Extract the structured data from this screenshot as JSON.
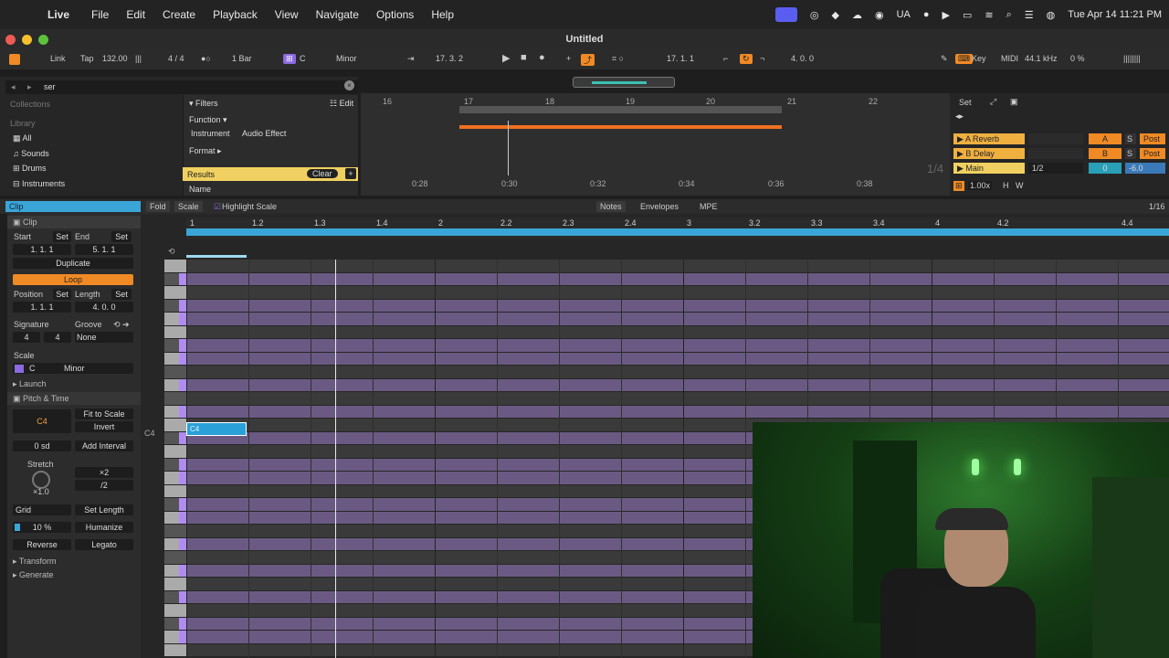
{
  "menubar": {
    "apple": "",
    "app": "Live",
    "items": [
      "File",
      "Edit",
      "Create",
      "Playback",
      "View",
      "Navigate",
      "Options",
      "Help"
    ],
    "status": {
      "ua": "UA",
      "datetime": "Tue Apr 14  11:21 PM"
    }
  },
  "window": {
    "title": "Untitled"
  },
  "control_bar": {
    "link": "Link",
    "tap": "Tap",
    "tempo": "132.00",
    "signature": "4 / 4",
    "quant": "1 Bar",
    "key_root": "C",
    "key_scale": "Minor",
    "arr_pos": "17.   3.   2",
    "loop_start": "17.   1.   1",
    "loop_len": "4.   0.   0",
    "key_btn": "Key",
    "midi_btn": "MIDI",
    "sample_rate": "44.1 kHz",
    "cpu": "0 %"
  },
  "browser": {
    "search_value": "ser",
    "collections_label": "Collections",
    "library_label": "Library",
    "library_items": [
      "All",
      "Sounds",
      "Drums",
      "Instruments"
    ],
    "filters_label": "Filters",
    "edit_label": "Edit",
    "function_label": "Function",
    "function_tags": [
      "Instrument",
      "Audio Effect"
    ],
    "format_label": "Format",
    "results_label": "Results",
    "clear_label": "Clear",
    "name_header": "Name"
  },
  "arrangement": {
    "bars": [
      "16",
      "17",
      "18",
      "19",
      "20",
      "21",
      "22"
    ],
    "times": [
      "0:28",
      "0:30",
      "0:32",
      "0:34",
      "0:36",
      "0:38"
    ]
  },
  "mixer": {
    "set_label": "Set",
    "returns": [
      {
        "name": "A Reverb",
        "letter": "A",
        "send": "S",
        "post": "Post"
      },
      {
        "name": "B Delay",
        "letter": "B",
        "send": "S",
        "post": "Post"
      }
    ],
    "main": {
      "name": "Main",
      "input": "1/2",
      "vol": "0",
      "pan": "-6.0"
    },
    "cue": "1/4",
    "speed": "1.00x",
    "h_label": "H",
    "w_label": "W"
  },
  "clip_bar": {
    "title": "Clip",
    "fold": "Fold",
    "scale": "Scale",
    "highlight": "Highlight Scale",
    "notes": "Notes",
    "envelopes": "Envelopes",
    "mpe": "MPE",
    "grid_res": "1/16"
  },
  "clip_panel": {
    "clip_header": "Clip",
    "start_label": "Start",
    "end_label": "End",
    "set_label": "Set",
    "start_value": "1.   1.   1",
    "end_value": "5.   1.   1",
    "duplicate": "Duplicate",
    "loop": "Loop",
    "position_label": "Position",
    "length_label": "Length",
    "position_value": "1.   1.   1",
    "length_value": "4.   0.   0",
    "signature_label": "Signature",
    "groove_label": "Groove",
    "sig_num": "4",
    "sig_den": "4",
    "groove_value": "None",
    "scale_label": "Scale",
    "scale_root": "C",
    "scale_mode": "Minor",
    "launch": "Launch",
    "pitch_time": "Pitch & Time",
    "note_name": "C4",
    "fit_to_scale": "Fit to Scale",
    "invert": "Invert",
    "transpose": "0 sd",
    "add_interval": "Add Interval",
    "stretch": "Stretch",
    "stretch_value": "×1.0",
    "x2": "×2",
    "div2": "/2",
    "grid": "Grid",
    "set_length": "Set Length",
    "humanize_amt": "10 %",
    "humanize": "Humanize",
    "reverse": "Reverse",
    "legato": "Legato",
    "transform": "Transform",
    "generate": "Generate"
  },
  "piano_roll": {
    "ruler": [
      "1",
      "1.2",
      "1.3",
      "1.4",
      "2",
      "2.2",
      "2.3",
      "2.4",
      "3",
      "3.2",
      "3.3",
      "3.4",
      "4",
      "4.2",
      "4.4"
    ],
    "c4_label": "C4",
    "note_label": "C4"
  },
  "colors": {
    "accent": "#3aa6d8",
    "scale_lane": "#6a5a83",
    "orange": "#f08a24",
    "yellow": "#f0d060"
  }
}
